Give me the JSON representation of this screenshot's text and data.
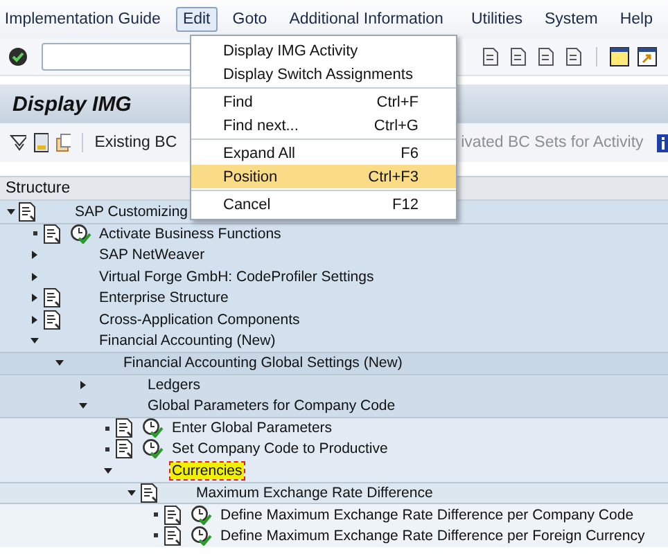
{
  "menu_bar": [
    {
      "label": "Implementation Guide",
      "selected": false
    },
    {
      "label": "Edit",
      "selected": true
    },
    {
      "label": "Goto",
      "selected": false
    },
    {
      "label": "Additional Information",
      "selected": false
    },
    {
      "label": "Utilities",
      "selected": false
    },
    {
      "label": "System",
      "selected": false
    },
    {
      "label": "Help",
      "selected": false
    }
  ],
  "title": "Display IMG",
  "app_toolbar": {
    "buttons": [
      {
        "label": "Existing BC"
      },
      {
        "label": "ivated BC Sets for Activity"
      }
    ]
  },
  "tree": {
    "header": "Structure",
    "nodes": [
      {
        "label": "SAP Customizing",
        "kind": "node",
        "documented": true,
        "expanded": true,
        "selected": false,
        "children": [
          {
            "label": "Activate Business Functions",
            "kind": "activity",
            "selected": false
          },
          {
            "label": "SAP NetWeaver",
            "kind": "node",
            "documented": false,
            "expanded": false,
            "selected": false
          },
          {
            "label": "Virtual Forge GmbH: CodeProfiler Settings",
            "kind": "node",
            "documented": false,
            "expanded": false,
            "selected": false
          },
          {
            "label": "Enterprise Structure",
            "kind": "node",
            "documented": true,
            "expanded": false,
            "selected": false
          },
          {
            "label": "Cross-Application Components",
            "kind": "node",
            "documented": true,
            "expanded": false,
            "selected": false
          },
          {
            "label": "Financial Accounting (New)",
            "kind": "node",
            "documented": false,
            "expanded": true,
            "selected": false,
            "children": [
              {
                "label": "Financial Accounting Global Settings (New)",
                "kind": "node",
                "documented": false,
                "expanded": true,
                "selected": false,
                "children": [
                  {
                    "label": "Ledgers",
                    "kind": "node",
                    "documented": false,
                    "expanded": false,
                    "selected": false
                  },
                  {
                    "label": "Global Parameters for Company Code",
                    "kind": "node",
                    "documented": false,
                    "expanded": true,
                    "selected": false,
                    "children": [
                      {
                        "label": "Enter Global Parameters",
                        "kind": "activity",
                        "selected": false
                      },
                      {
                        "label": "Set Company Code to Productive",
                        "kind": "activity",
                        "selected": false
                      },
                      {
                        "label": "Currencies",
                        "kind": "node",
                        "documented": false,
                        "expanded": true,
                        "selected": true,
                        "children": [
                          {
                            "label": "Maximum Exchange Rate Difference",
                            "kind": "node",
                            "documented": true,
                            "expanded": true,
                            "selected": false,
                            "children": [
                              {
                                "label": "Define Maximum Exchange Rate Difference per Company Code",
                                "kind": "activity",
                                "selected": false
                              },
                              {
                                "label": "Define Maximum Exchange Rate Difference per Foreign Currency",
                                "kind": "activity",
                                "selected": false
                              }
                            ]
                          }
                        ]
                      }
                    ]
                  }
                ]
              }
            ]
          }
        ]
      }
    ]
  },
  "edit_menu": {
    "groups": [
      [
        {
          "label": "Display IMG Activity",
          "selected": false
        },
        {
          "label": "Display Switch Assignments",
          "selected": false
        }
      ],
      [
        {
          "label": "Find",
          "shortcut": "Ctrl+F",
          "selected": false
        },
        {
          "label": "Find next...",
          "shortcut": "Ctrl+G",
          "selected": false
        }
      ],
      [
        {
          "label": "Expand All",
          "shortcut": "F6",
          "selected": false
        },
        {
          "label": "Position",
          "shortcut": "Ctrl+F3",
          "selected": true
        }
      ],
      [
        {
          "label": "Cancel",
          "shortcut": "F12",
          "selected": false
        }
      ]
    ]
  }
}
